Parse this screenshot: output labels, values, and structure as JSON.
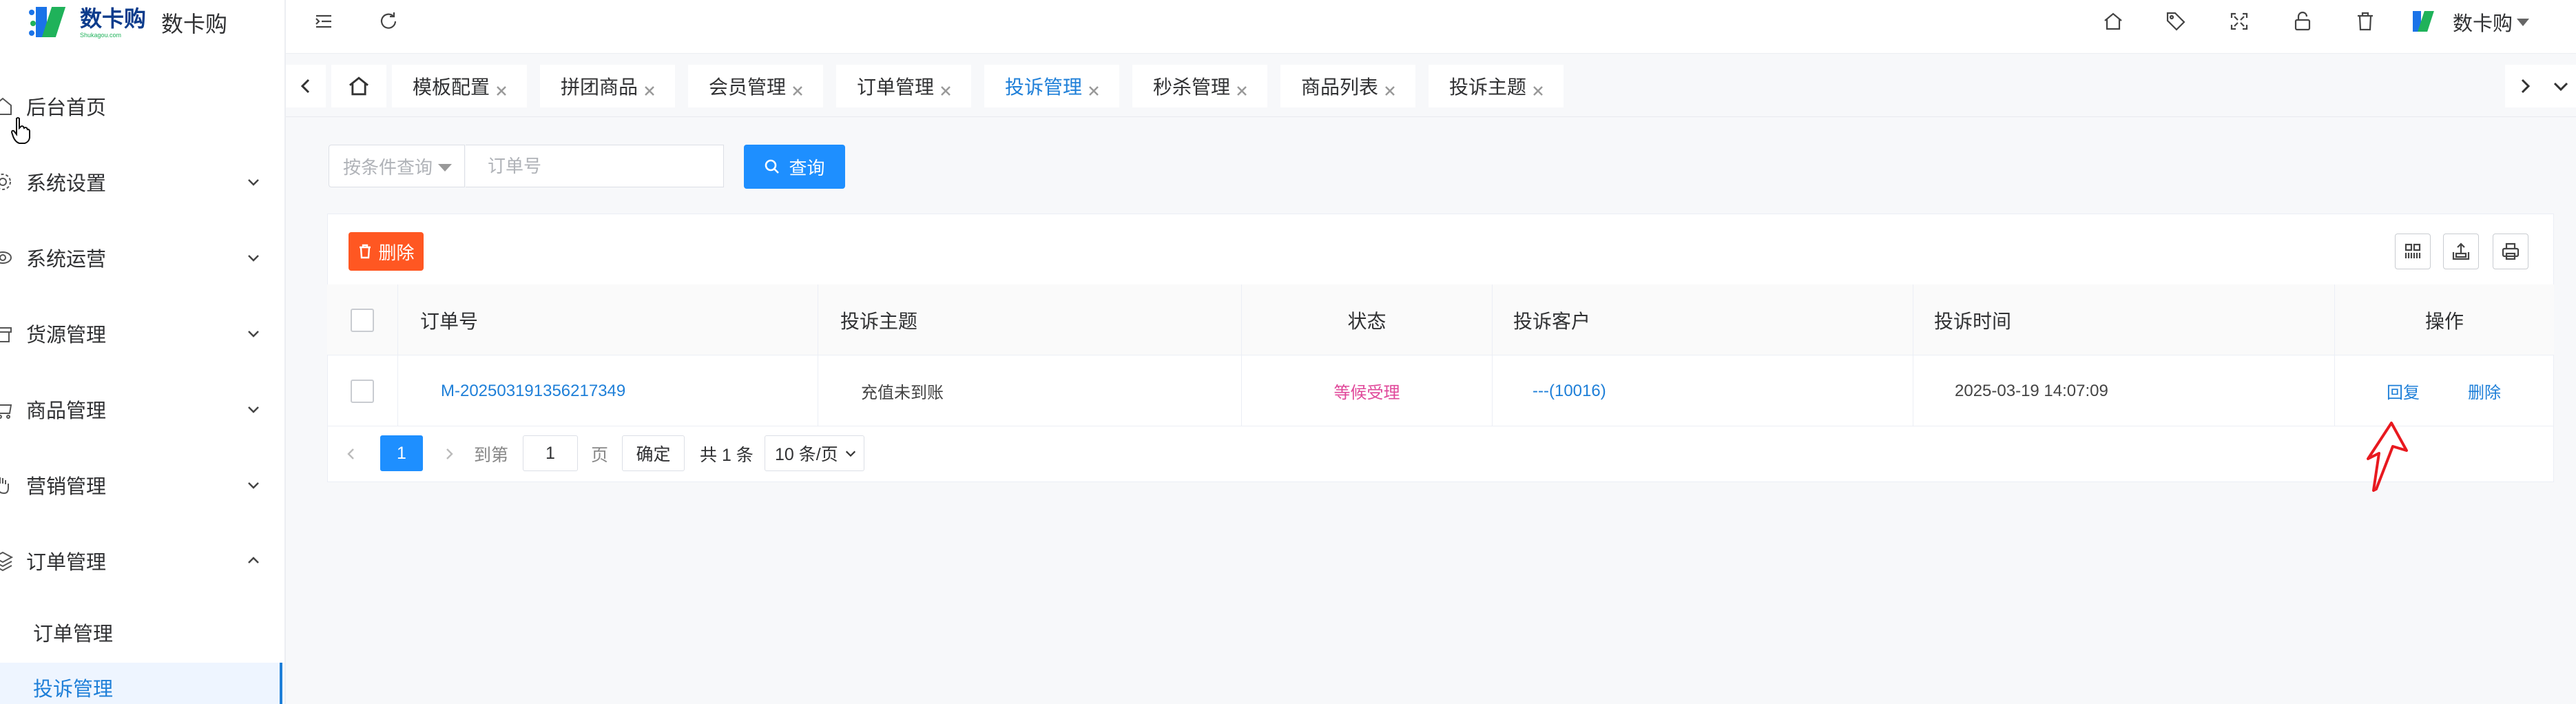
{
  "brand": {
    "logo_text": "数卡购",
    "logo_sub": "Shukagou.com",
    "app_name": "数卡购"
  },
  "sidebar": {
    "items": [
      {
        "label": "后台首页",
        "icon": "home-icon"
      },
      {
        "label": "系统设置",
        "icon": "gear-icon",
        "expandable": true
      },
      {
        "label": "系统运营",
        "icon": "eye-icon",
        "expandable": true
      },
      {
        "label": "货源管理",
        "icon": "store-icon",
        "expandable": true
      },
      {
        "label": "商品管理",
        "icon": "cart-icon",
        "expandable": true
      },
      {
        "label": "营销管理",
        "icon": "hand-icon",
        "expandable": true
      },
      {
        "label": "订单管理",
        "icon": "layers-icon",
        "expandable": true,
        "expanded": true
      }
    ],
    "sub_items": [
      {
        "label": "订单管理"
      },
      {
        "label": "投诉管理",
        "active": true
      }
    ]
  },
  "topbar": {
    "icons": [
      "menu-fold-icon",
      "refresh-icon",
      "home-icon",
      "tag-icon",
      "fullscreen-icon",
      "lock-icon",
      "trash-icon"
    ],
    "user_name": "数卡购"
  },
  "tabs": [
    {
      "label": "模板配置"
    },
    {
      "label": "拼团商品"
    },
    {
      "label": "会员管理"
    },
    {
      "label": "订单管理"
    },
    {
      "label": "投诉管理",
      "active": true
    },
    {
      "label": "秒杀管理"
    },
    {
      "label": "商品列表"
    },
    {
      "label": "投诉主题"
    }
  ],
  "search": {
    "select_placeholder": "按条件查询",
    "input_placeholder": "订单号",
    "button_label": "查询"
  },
  "toolbar": {
    "delete_label": "删除"
  },
  "table": {
    "columns": [
      "订单号",
      "投诉主题",
      "状态",
      "投诉客户",
      "投诉时间",
      "操作"
    ],
    "rows": [
      {
        "order_no": "M-202503191356217349",
        "topic": "充值未到账",
        "status": "等候受理",
        "customer": "---(10016)",
        "time": "2025-03-19 14:07:09",
        "action_reply": "回复",
        "action_delete": "删除"
      }
    ]
  },
  "pager": {
    "current_page": "1",
    "goto_label": "到第",
    "goto_value": "1",
    "page_unit": "页",
    "confirm_label": "确定",
    "total_label": "共 1 条",
    "page_size_label": "10 条/页"
  },
  "colors": {
    "accent": "#1e8fff",
    "link": "#1e7fd8",
    "danger": "#ff5722",
    "status_pink": "#e0489a",
    "annotation_red": "#e8191f"
  }
}
